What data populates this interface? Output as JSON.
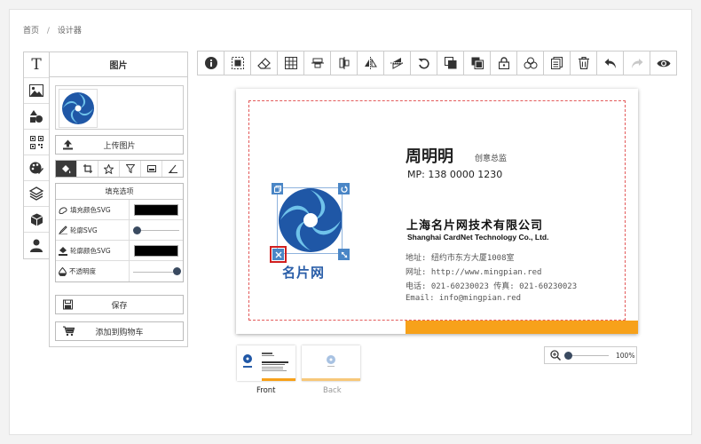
{
  "breadcrumb": {
    "home": "首页",
    "sep": "/",
    "current": "设计器"
  },
  "vtabs": [
    {
      "name": "text",
      "icon": "text-icon"
    },
    {
      "name": "image",
      "icon": "image-icon"
    },
    {
      "name": "shapes",
      "icon": "shapes-icon"
    },
    {
      "name": "qrcode",
      "icon": "qrcode-icon"
    },
    {
      "name": "clipart",
      "icon": "clipart-icon"
    },
    {
      "name": "layers",
      "icon": "layers-icon"
    },
    {
      "name": "templates",
      "icon": "box-icon"
    },
    {
      "name": "user",
      "icon": "user-icon"
    }
  ],
  "panel": {
    "title": "图片",
    "upload_label": "上传图片",
    "fill_title": "填充选项",
    "rows": [
      {
        "label": "填充颜色SVG",
        "kind": "swatch",
        "color": "#000000"
      },
      {
        "label": "轮廓SVG",
        "kind": "slider",
        "value": 0.0
      },
      {
        "label": "轮廓颜色SVG",
        "kind": "swatch",
        "color": "#000000"
      },
      {
        "label": "不透明度",
        "kind": "slider",
        "value": 1.0
      }
    ],
    "save_label": "保存",
    "cart_label": "添加到购物车"
  },
  "toolbar": [
    "info-icon",
    "select-icon",
    "eraser-icon",
    "grid-icon",
    "align-center-h-icon",
    "align-center-v-icon",
    "flip-horizontal-icon",
    "flip-vertical-icon",
    "rotate-icon",
    "bring-front-icon",
    "send-back-icon",
    "lock-icon",
    "group-icon",
    "copy-icon",
    "trash-icon",
    "undo-icon",
    "redo-icon",
    "preview-icon"
  ],
  "card": {
    "name": "周明明",
    "title": "创意总监",
    "mp": "MP: 138 0000 1230",
    "company": "上海名片网技术有限公司",
    "company_en": "Shanghai CardNet Technology Co., Ltd.",
    "address": "地址: 纽约市东方大厦1008室",
    "website": "网址: http://www.mingpian.red",
    "phone": "电话: 021-60230023  传真: 021-60230023",
    "email": "Email: info@mingpian.red",
    "logo_text": "名片网",
    "accent": "#f7a11a",
    "brand": "#2a5ea8"
  },
  "pages": {
    "front": "Front",
    "back": "Back"
  },
  "zoom": {
    "label": "100%",
    "value": 0.0
  }
}
